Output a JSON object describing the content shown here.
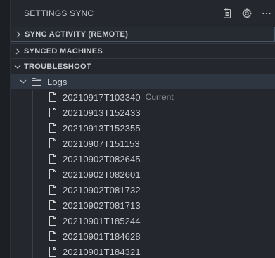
{
  "view": {
    "title": "SETTINGS SYNC",
    "actions": [
      {
        "icon": "notebook-icon"
      },
      {
        "icon": "gear-icon"
      },
      {
        "icon": "ellipsis-icon",
        "label": "···"
      }
    ]
  },
  "sections": [
    {
      "title": "SYNC ACTIVITY (REMOTE)",
      "expanded": false
    },
    {
      "title": "SYNCED MACHINES",
      "expanded": false
    },
    {
      "title": "TROUBLESHOOT",
      "expanded": true
    }
  ],
  "troubleshoot": {
    "folder": {
      "label": "Logs",
      "icon": "folder-icon",
      "expanded": true
    },
    "files": [
      {
        "name": "20210917T103340",
        "description": "Current"
      },
      {
        "name": "20210913T152433"
      },
      {
        "name": "20210913T152355"
      },
      {
        "name": "20210907T151153"
      },
      {
        "name": "20210902T082645"
      },
      {
        "name": "20210902T082601"
      },
      {
        "name": "20210902T081732"
      },
      {
        "name": "20210902T081713"
      },
      {
        "name": "20210901T185244"
      },
      {
        "name": "20210901T184628"
      },
      {
        "name": "20210901T184321"
      }
    ]
  },
  "colors": {
    "background": "#24272e",
    "focus_border": "#4a5564",
    "text": "#c9cbcf",
    "description": "#8b8f96"
  }
}
